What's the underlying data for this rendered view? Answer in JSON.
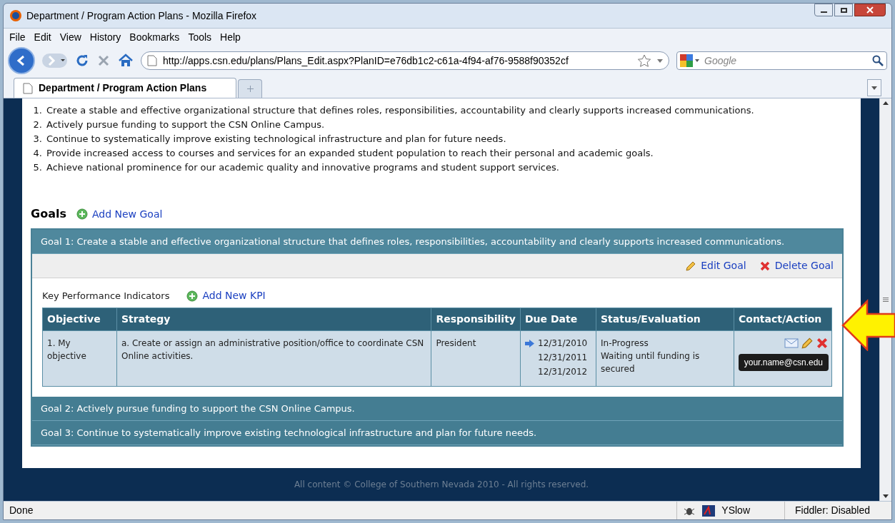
{
  "window": {
    "title": "Department / Program Action Plans - Mozilla Firefox"
  },
  "menu": [
    "File",
    "Edit",
    "View",
    "History",
    "Bookmarks",
    "Tools",
    "Help"
  ],
  "address": {
    "value": "http://apps.csn.edu/plans/Plans_Edit.aspx?PlanID=e76db1c2-c61a-4f94-af76-9588f90352cf"
  },
  "search": {
    "placeholder": "Google"
  },
  "tabs": [
    {
      "label": "Department / Program Action Plans",
      "selected": true
    }
  ],
  "priorities": [
    {
      "number": "1.",
      "text": "Create a stable and effective organizational structure that defines roles, responsibilities, accountability and clearly supports increased communications."
    },
    {
      "number": "2.",
      "text": "Actively pursue funding to support the CSN Online Campus."
    },
    {
      "number": "3.",
      "text": "Continue to systematically improve existing technological infrastructure and plan for future needs."
    },
    {
      "number": "4.",
      "text": "Provide increased access to courses and services for an expanded student population to reach their personal and academic goals."
    },
    {
      "number": "5.",
      "text": "Achieve national prominence for our academic quality and innovative programs and student support services."
    }
  ],
  "goals_heading": "Goals",
  "add_goal": "Add New Goal",
  "goals": [
    {
      "title": "Goal 1: Create a stable and effective organizational structure that defines roles, responsibilities, accountability and clearly supports increased communications.",
      "expanded": true
    },
    {
      "title": "Goal 2: Actively pursue funding to support the CSN Online Campus.",
      "expanded": false
    },
    {
      "title": "Goal 3: Continue to systematically improve existing technological infrastructure and plan for future needs.",
      "expanded": false
    }
  ],
  "goal_actions": {
    "edit": "Edit Goal",
    "delete": "Delete Goal"
  },
  "kpi": {
    "label": "Key Performance Indicators",
    "add": "Add New KPI"
  },
  "table": {
    "columns": [
      "Objective",
      "Strategy",
      "Responsibility",
      "Due Date",
      "Status/Evaluation",
      "Contact/Action"
    ],
    "rows": [
      {
        "objective": "1. My objective",
        "strategy": "a. Create or assign an administrative position/office to coordinate CSN Online activities.",
        "responsibility": "President",
        "due_dates": [
          {
            "date": "12/31/2010",
            "current": true
          },
          {
            "date": "12/31/2011",
            "current": false
          },
          {
            "date": "12/31/2012",
            "current": false
          }
        ],
        "status": "In-Progress",
        "evaluation": "Waiting until funding is secured",
        "tooltip": "your.name@csn.edu"
      }
    ]
  },
  "footer": "All content © College of Southern Nevada 2010 - All rights reserved.",
  "status_bar": {
    "text": "Done",
    "yslow": "YSlow",
    "fiddler": "Fiddler: Disabled"
  }
}
